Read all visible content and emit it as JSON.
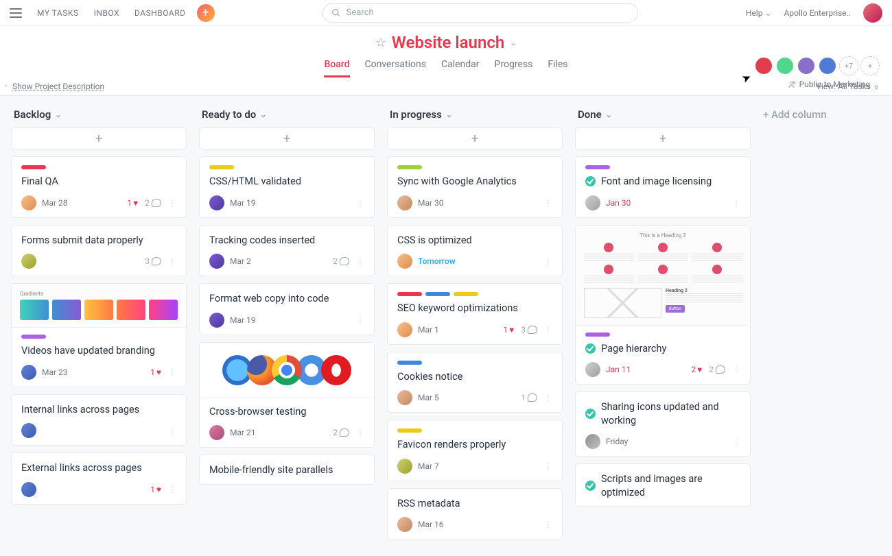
{
  "topbar": {
    "nav": [
      "MY TASKS",
      "INBOX",
      "DASHBOARD"
    ],
    "search_placeholder": "Search",
    "help": "Help",
    "workspace": "Apollo Enterprise.."
  },
  "project": {
    "title": "Website launch",
    "tabs": [
      "Board",
      "Conversations",
      "Calendar",
      "Progress",
      "Files"
    ],
    "active_tab": 0,
    "members_extra": "+7",
    "privacy": "Public to Marketing",
    "desc_link": "Show Project Description",
    "view": "View: All Tasks",
    "add_column": "+ Add column"
  },
  "columns": [
    {
      "name": "Backlog",
      "cards": [
        {
          "tags": [
            "red"
          ],
          "title": "Final QA",
          "avatar": "a1",
          "due": "Mar 28",
          "likes": 1,
          "comments": 2
        },
        {
          "title": "Forms submit data properly",
          "avatar": "a3",
          "comments": 3
        },
        {
          "cover": "gradients",
          "cover_label": "Gradients",
          "tags": [
            "purp"
          ],
          "title": "Videos have updated branding",
          "avatar": "a7",
          "due": "Mar 23",
          "likes": 1
        },
        {
          "title": "Internal links across pages",
          "avatar": "a7"
        },
        {
          "title": "External links across pages",
          "avatar": "a7",
          "likes": 1
        }
      ]
    },
    {
      "name": "Ready to do",
      "cards": [
        {
          "tags": [
            "yel"
          ],
          "title": "CSS/HTML validated",
          "avatar": "a2",
          "due": "Mar 19"
        },
        {
          "title": "Tracking codes inserted",
          "avatar": "a2",
          "due": "Mar 2",
          "comments": 2
        },
        {
          "title": "Format web copy into code",
          "avatar": "a2",
          "due": "Mar 19"
        },
        {
          "cover": "browsers",
          "title": "Cross-browser testing",
          "avatar": "a5",
          "due": "Mar 21",
          "comments": 2
        },
        {
          "title": "Mobile-friendly site parallels"
        }
      ]
    },
    {
      "name": "In progress",
      "cards": [
        {
          "tags": [
            "lime"
          ],
          "title": "Sync with Google Analytics",
          "avatar": "a4",
          "due": "Mar 30"
        },
        {
          "title": "CSS is optimized",
          "avatar": "a1",
          "due": "Tomorrow",
          "due_class": "soon"
        },
        {
          "tags": [
            "red",
            "blue",
            "yel"
          ],
          "title": "SEO keyword optimizations",
          "avatar": "a1",
          "due": "Mar 1",
          "likes": 1,
          "comments": 3
        },
        {
          "tags": [
            "blue"
          ],
          "title": "Cookies notice",
          "avatar": "a4",
          "due": "Mar 5",
          "comments": 1
        },
        {
          "tags": [
            "yel"
          ],
          "title": "Favicon renders properly",
          "avatar": "a3",
          "due": "Mar 7"
        },
        {
          "title": "RSS metadata",
          "avatar": "a4",
          "due": "Mar 16"
        }
      ]
    },
    {
      "name": "Done",
      "cards": [
        {
          "tags": [
            "purp"
          ],
          "complete": true,
          "title": "Font and image licensing",
          "avatar": "a8",
          "due": "Jan 30",
          "due_class": "done"
        },
        {
          "cover": "wireframe",
          "cover_label": "This is a Heading 2",
          "cover_sub": "Heading 2",
          "tags": [
            "purp"
          ],
          "complete": true,
          "title": "Page hierarchy",
          "avatar": "a8",
          "due": "Jan 11",
          "due_class": "done",
          "likes": 2,
          "comments": 2
        },
        {
          "complete": true,
          "title": "Sharing icons updated and working",
          "avatar": "a6",
          "due": "Friday"
        },
        {
          "complete": true,
          "title": "Scripts and images are optimized"
        }
      ]
    }
  ]
}
